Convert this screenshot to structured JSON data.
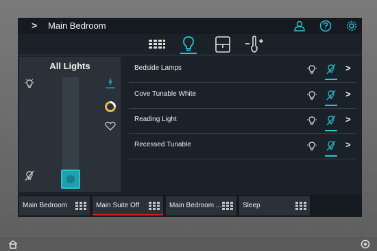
{
  "header": {
    "back_chevron": ">",
    "title": "Main Bedroom",
    "icons": [
      "user-icon",
      "help-icon",
      "gear-icon"
    ]
  },
  "tabs": [
    {
      "name": "keypad-icon",
      "active": false
    },
    {
      "name": "lightbulb-icon",
      "active": true
    },
    {
      "name": "shade-icon",
      "active": false
    },
    {
      "name": "thermostat-icon",
      "active": false
    }
  ],
  "left_panel": {
    "title": "All Lights",
    "brightness": 0
  },
  "lights": [
    {
      "label": "Bedside Lamps",
      "state": "off"
    },
    {
      "label": "Cove Tunable White",
      "state": "off"
    },
    {
      "label": "Reading Light",
      "state": "off"
    },
    {
      "label": "Recessed Tunable",
      "state": "off"
    }
  ],
  "row_arrow": ">",
  "scenes": [
    {
      "label": "Main Bedroom",
      "active": false
    },
    {
      "label": "Main Suite Off",
      "active": true
    },
    {
      "label": "Main Bedroom ...",
      "active": false
    },
    {
      "label": "Sleep",
      "active": false
    }
  ],
  "colors": {
    "accent": "#2bc4d6",
    "active_scene": "#d62020"
  }
}
